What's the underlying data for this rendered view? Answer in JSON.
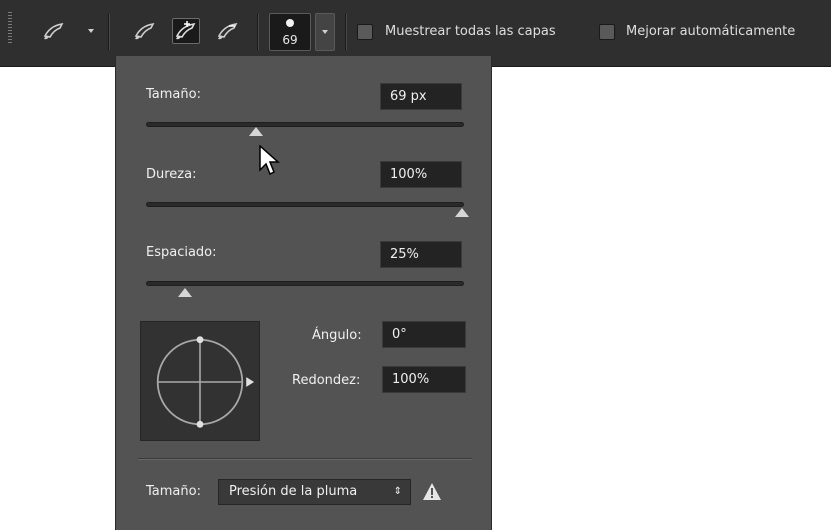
{
  "toolbar": {
    "icons": [
      "brush-tool-icon",
      "new-selection-icon",
      "add-to-selection-icon",
      "subtract-from-selection-icon"
    ],
    "brush_preset_size": "69",
    "sample_all_layers_label": "Muestrear todas las capas",
    "auto_enhance_label": "Mejorar automáticamente"
  },
  "panel": {
    "size": {
      "label": "Tamaño:",
      "value": "69 px",
      "level": 0.35
    },
    "hardness": {
      "label": "Dureza:",
      "value": "100%",
      "level": 1.0
    },
    "spacing": {
      "label": "Espaciado:",
      "value": "25%",
      "level": 0.12
    },
    "angle": {
      "label": "Ángulo:",
      "value": "0°"
    },
    "roundness": {
      "label": "Redondez:",
      "value": "100%"
    },
    "size_control": {
      "label": "Tamaño:",
      "selected": "Presión de la pluma",
      "arrows": "⇕"
    },
    "warning_icon": "warning-icon"
  },
  "colors": {
    "toolbar": "#2f2f2f",
    "panel": "#535353",
    "field": "#232323",
    "canvas": "#ffffff"
  }
}
